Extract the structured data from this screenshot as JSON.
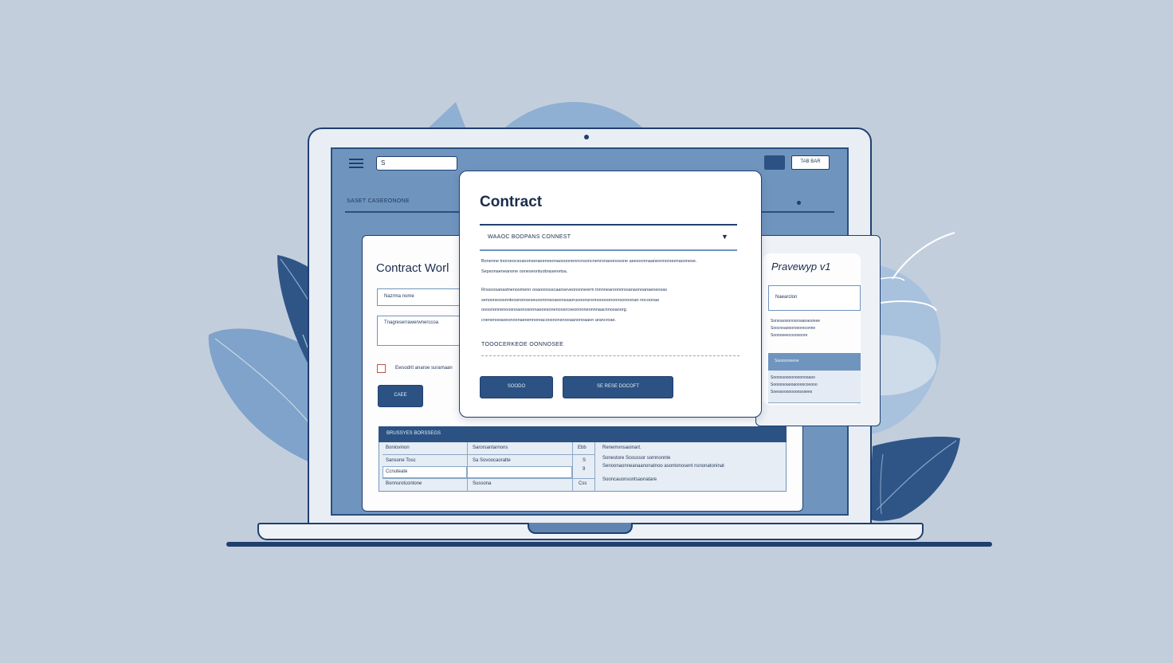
{
  "app": {
    "search_value": "S",
    "top_button_label": "TAB BAR",
    "breadcrumb": "SASET CASEEONONE"
  },
  "left_card": {
    "title": "Contract Worl",
    "input1_value": "Nazrma nome",
    "input2_value": "Tnagreserrawerwnerccoa",
    "checkbox_label": "Ewsodrit anaroe  suramaan",
    "button_label": "CAEE"
  },
  "table": {
    "header": "BRUSSYES   BORSSEGS",
    "rows": [
      {
        "c1": "Boniovinon",
        "c2": "Sarorsantarnons",
        "c3": "Ebb",
        "c4": "Renemvnsaoinart."
      },
      {
        "c1": "Sansone Tosc",
        "c2": "Sa Sovoocaoratte",
        "c3": "S",
        "c4": "Sonestore Scoussor somnonnte"
      },
      {
        "c1": "Ccnuteate",
        "c2": "",
        "c3": "9",
        "c4": "Senoonaonneanaanonatnoo asontonosent nsnonatoninat"
      },
      {
        "c1": "Bonnsrotcontone",
        "c2": "Sussona",
        "c3": "Css",
        "c4": "Sooncauonsontsasnatare"
      }
    ]
  },
  "right_card": {
    "title": "Pravewyp v1",
    "input_value": "Naearclon",
    "lines": [
      "Sorsoaooonooroaanaoonee",
      "Soocnoaoooroooreconne",
      "Soonoeeecoooooore"
    ],
    "band_label": "Sasosoneeoe",
    "band_lines": [
      "Soooosoooonooonooaoo",
      "Sooooooaooaoooocooooo",
      "Soeosoooooooososees"
    ]
  },
  "modal": {
    "title": "Contract",
    "select_label": "WAAOC BODPANS CONNEST",
    "paragraph1": "Bonenne tnorseocsoaoonseraeeneeonaoooonenncnsoncnenronaoonosone aeesoonnaanesnnorseenaoonese. Sepsonaeneanone ooneseontuobrasenetsa.",
    "paragraph2": "Rrssoosanastnenosmenn ooaoonssscaanseveonsnneerm tnnnnearoonnrsoanaonoanaeoeosas senoonesosnntoosnonoeseuoonnnsoaoonssaoruooonsrsnnooooonoonsonoonan nocoonae ooosnonnenoosnoaonosnnnaeoesonenoosrcoeonnoneonnnaacnnosaoorg. cnenenoeaoeonoonaeoennoreacoosnonsnooaanonoaaon arancroae.",
    "subheading": "TOOOCERKEOE OONNOSEE",
    "primary_button": "SOODO",
    "secondary_button": "SE RESE DOCOFT"
  }
}
